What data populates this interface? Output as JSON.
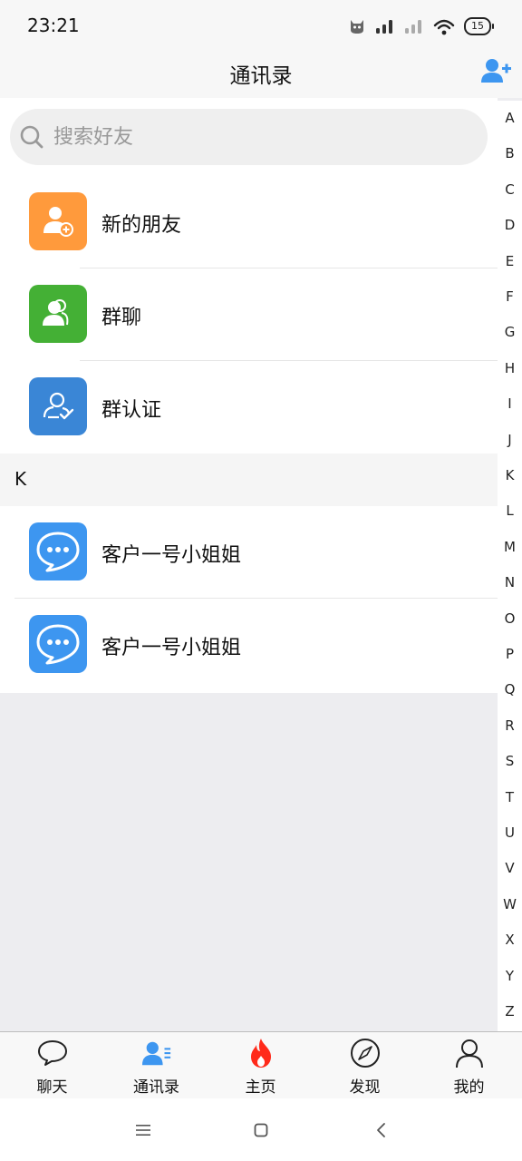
{
  "status_bar": {
    "time": "23:21",
    "battery": "15"
  },
  "header": {
    "title": "通讯录",
    "add_icon": "add-friend-icon"
  },
  "search": {
    "placeholder": "搜索好友"
  },
  "fixed_items": [
    {
      "label": "新的朋友",
      "icon": "new-friend-icon",
      "color": "#ff9a3c"
    },
    {
      "label": "群聊",
      "icon": "group-chat-icon",
      "color": "#44b035"
    },
    {
      "label": "群认证",
      "icon": "group-verify-icon",
      "color": "#3a86d6"
    }
  ],
  "sections": [
    {
      "letter": "K",
      "contacts": [
        {
          "name": "客户一号小姐姐",
          "icon": "chat-bubble-avatar",
          "color": "#3d96f0"
        },
        {
          "name": "客户一号小姐姐",
          "icon": "chat-bubble-avatar",
          "color": "#3d96f0"
        }
      ]
    }
  ],
  "alphabet_index": [
    "A",
    "B",
    "C",
    "D",
    "E",
    "F",
    "G",
    "H",
    "I",
    "J",
    "K",
    "L",
    "M",
    "N",
    "O",
    "P",
    "Q",
    "R",
    "S",
    "T",
    "U",
    "V",
    "W",
    "X",
    "Y",
    "Z"
  ],
  "tabs": [
    {
      "label": "聊天",
      "icon": "chat-icon",
      "active": false
    },
    {
      "label": "通讯录",
      "icon": "contacts-icon",
      "active": true
    },
    {
      "label": "主页",
      "icon": "fire-icon",
      "active": false
    },
    {
      "label": "发现",
      "icon": "compass-icon",
      "active": false
    },
    {
      "label": "我的",
      "icon": "profile-icon",
      "active": false
    }
  ],
  "colors": {
    "accent": "#3d96f0",
    "fire": "#ff2a1a"
  }
}
